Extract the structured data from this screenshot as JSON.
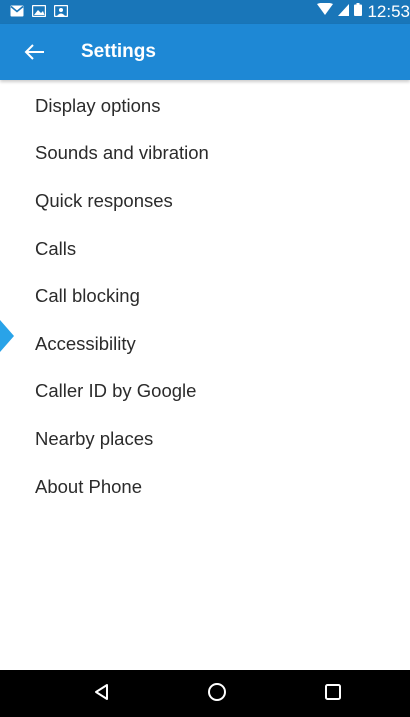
{
  "status_bar": {
    "time": "12:53",
    "left_icons": [
      "gmail-icon",
      "image-icon",
      "photo-icon"
    ],
    "right_icons": [
      "wifi-icon",
      "cell-signal-icon",
      "battery-icon"
    ]
  },
  "app_bar": {
    "title": "Settings",
    "back_icon": "arrow-back-icon"
  },
  "menu": {
    "items": [
      {
        "label": "Display options"
      },
      {
        "label": "Sounds and vibration"
      },
      {
        "label": "Quick responses"
      },
      {
        "label": "Calls"
      },
      {
        "label": "Call blocking"
      },
      {
        "label": "Accessibility"
      },
      {
        "label": "Caller ID by Google"
      },
      {
        "label": "Nearby places"
      },
      {
        "label": "About Phone"
      }
    ]
  },
  "nav_bar": {
    "buttons": [
      "back-triangle-icon",
      "home-circle-icon",
      "recents-square-icon"
    ]
  },
  "colors": {
    "status_bar": "#1976b9",
    "app_bar": "#1e88d5",
    "text": "#2b2b2b",
    "pointer": "#29a3e8"
  }
}
